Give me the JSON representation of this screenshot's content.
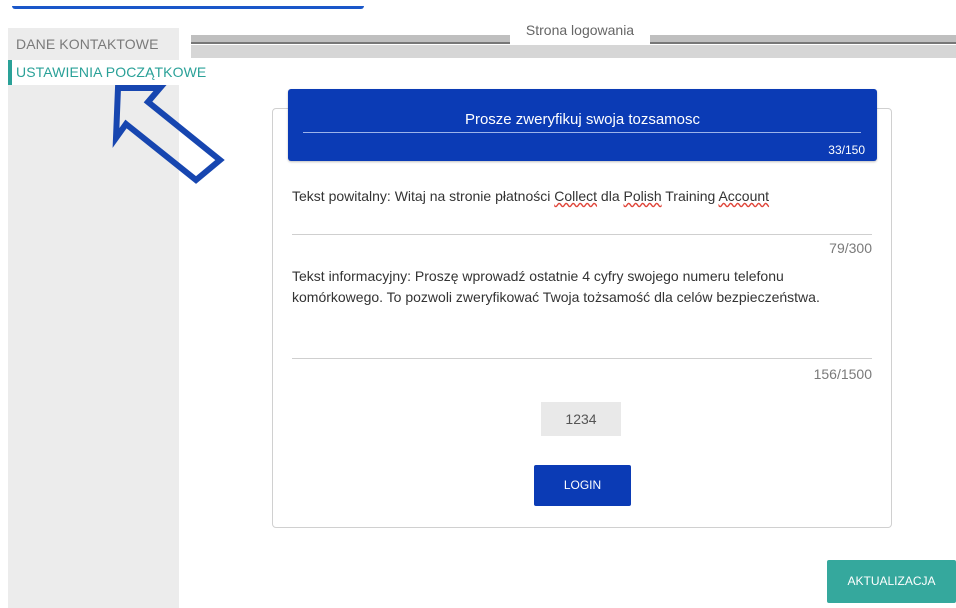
{
  "nav": {
    "contact_label": "DANE KONTAKTOWE",
    "initial_label": "USTAWIENIA POCZĄTKOWE"
  },
  "section": {
    "title": "Strona logowania"
  },
  "banner": {
    "title": "Prosze zweryfikuj swoja tozsamosc",
    "count": "33/150"
  },
  "welcome": {
    "prefix": "Tekst powitalny: Witaj na stronie płatności ",
    "word1": "Collect",
    "mid1": " dla ",
    "word2": "Polish",
    "mid2": " Training ",
    "word3": "Account",
    "count": "79/300"
  },
  "info": {
    "line1": "Tekst informacyjny: Proszę wprowadź ostatnie 4 cyfry swojego numeru telefonu",
    "line2": "komórkowego. To pozwoli zweryfikować Twoja tożsamość dla celów bezpieczeństwa.",
    "count": "156/1500"
  },
  "code": {
    "value": "1234"
  },
  "buttons": {
    "login": "LOGIN",
    "update": "AKTUALIZACJA"
  },
  "colors": {
    "brand_blue": "#0b3bb5",
    "accent_teal": "#35a89d"
  },
  "icons": {
    "arrow": "arrow-up-left-icon"
  }
}
